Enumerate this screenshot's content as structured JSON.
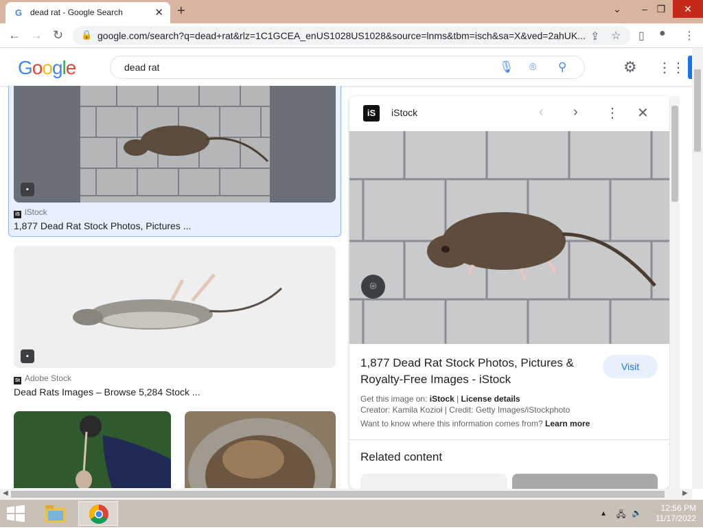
{
  "browser": {
    "tab_title": "dead rat - Google Search",
    "tab_close": "✕",
    "new_tab": "+",
    "url": "google.com/search?q=dead+rat&rlz=1C1GCEA_enUS1028US1028&source=lnms&tbm=isch&sa=X&ved=2ahUK..."
  },
  "google": {
    "logo": "Google",
    "query": "dead rat"
  },
  "results": [
    {
      "source": "iStock",
      "title": "1,877 Dead Rat Stock Photos, Pictures ..."
    },
    {
      "source": "Adobe Stock",
      "title": "Dead Rats Images – Browse 5,284 Stock ..."
    }
  ],
  "panel": {
    "source": "iStock",
    "title": "1,877 Dead Rat Stock Photos, Pictures & Royalty-Free Images - iStock",
    "visit": "Visit",
    "get_image_label": "Get this image on:",
    "get_image_source": "iStock",
    "license_details": "License details",
    "creator": "Creator: Kamila Kozioł | Credit: Getty Images/iStockphoto",
    "want_to_know": "Want to know where this information comes from?",
    "learn_more": "Learn more",
    "related_content": "Related content"
  },
  "taskbar": {
    "time": "12:56 PM",
    "date": "11/17/2022"
  },
  "colors": {
    "tabbar": "#d8b59f",
    "accent": "#1a73e8",
    "close_red": "#c42b1c"
  }
}
